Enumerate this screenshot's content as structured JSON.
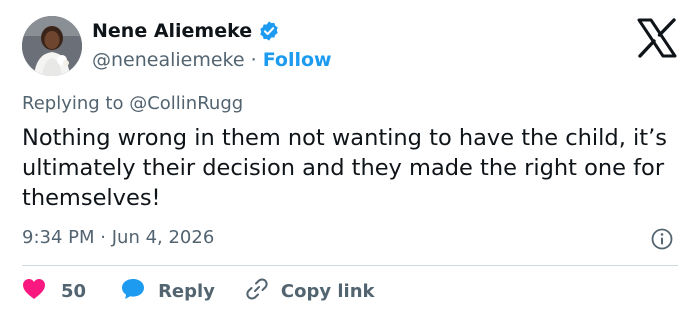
{
  "author": {
    "name": "Nene Aliemeke",
    "handle": "@nenealiemeke",
    "separator": "·",
    "follow_label": "Follow"
  },
  "reply_context": {
    "prefix": "Replying to",
    "mention": "@CollinRugg"
  },
  "tweet": {
    "text": "Nothing wrong in them not wanting to have the child, it’s ultimately their decision and they made the right one for themselves!",
    "time": "9:34 PM",
    "date_separator": "·",
    "date": "Jun 4, 2026"
  },
  "actions": {
    "like_count": "50",
    "reply_label": "Reply",
    "copy_link_label": "Copy link"
  },
  "icons": {
    "verified": "verified-badge-icon",
    "logo": "x-logo-icon",
    "info": "info-icon",
    "like": "heart-icon",
    "reply": "speech-bubble-icon",
    "copy": "link-icon"
  },
  "colors": {
    "brand_blue": "#1d9bf0",
    "like_pink": "#f91880",
    "text_primary": "#0f1419",
    "text_secondary": "#536471",
    "divider": "#cfd9de"
  }
}
